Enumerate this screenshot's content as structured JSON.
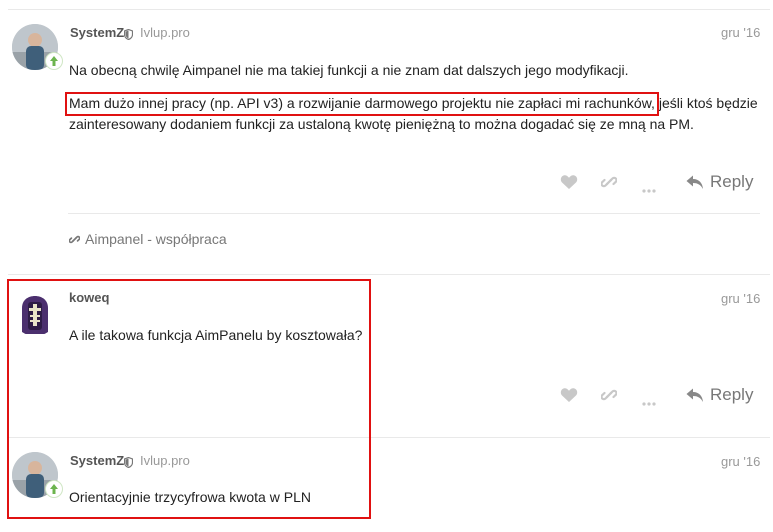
{
  "posts": [
    {
      "username": "SystemZ",
      "flair": "Ivlup.pro",
      "date": "gru '16",
      "paragraph1": "Na obecną chwilę Aimpanel nie ma takiej funkcji a nie znam dat dalszych jego modyfikacji.",
      "paragraph2_highlight": "Mam dużo innej pracy (np. API v3) a rozwijanie darmowego projektu nie zapłaci mi rachunków,",
      "paragraph2_rest": " jeśli ktoś będzie",
      "paragraph2_line2": "zainteresowany dodaniem funkcji za ustaloną kwotę pieniężną to można dogadać się ze mną na PM.",
      "reply_label": "Reply",
      "link_label": "Aimpanel - współpraca"
    },
    {
      "username": "koweq",
      "date": "gru '16",
      "text": "A ile takowa funkcja AimPanelu by kosztowała?",
      "reply_label": "Reply"
    },
    {
      "username": "SystemZ",
      "flair": "Ivlup.pro",
      "date": "gru '16",
      "text": "Orientacyjnie trzycyfrowa kwota w PLN"
    }
  ],
  "colors": {
    "highlight_box": "#e01111",
    "muted": "#999999",
    "icon": "#c8c8c8",
    "badge_arrow": "#6cb44e"
  },
  "icons": [
    "heart-icon",
    "link-icon",
    "more-icon",
    "reply-icon",
    "shield-icon",
    "level-up-badge-icon"
  ]
}
